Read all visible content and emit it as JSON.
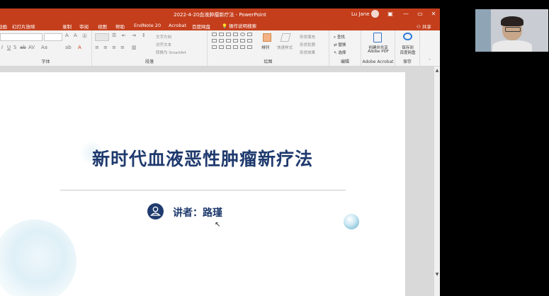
{
  "titlebar": {
    "doc_title": "2022-4-20血液肿瘤新疗法 - PowerPoint",
    "user_name": "Lu Jane",
    "minimize": "—",
    "restore": "▭",
    "close": "✕"
  },
  "tabs": [
    "动画",
    "幻灯片放映",
    "录制",
    "审阅",
    "视图",
    "帮助",
    "EndNote 20",
    "Acrobat",
    "百度网盘"
  ],
  "tell_me": "操作说明搜索",
  "share": "共享",
  "ribbon": {
    "groups": {
      "font": "字体",
      "paragraph": "段落",
      "drawing": "绘图",
      "editing": "编辑",
      "acrobat": "Adobe Acrobat",
      "save": "保存"
    },
    "paragraph": {
      "text_direction": "文字方向",
      "align_text": "对齐文本",
      "smartart": "转换为 SmartArt"
    },
    "drawing": {
      "arrange": "排列",
      "quick_styles": "快速样式",
      "shape_fill": "形状填充",
      "shape_outline": "形状轮廓",
      "shape_effects": "形状效果"
    },
    "editing": {
      "find": "查找",
      "replace": "替换",
      "select": "选择"
    },
    "acrobat": {
      "line1": "创建并共享",
      "line2": "Adobe PDF"
    },
    "baidu": {
      "line1": "保存到",
      "line2": "百度网盘"
    }
  },
  "slide": {
    "title": "新时代血液恶性肿瘤新疗法",
    "speaker": "讲者：路瑾"
  },
  "colors": {
    "accent": "#c43e1c",
    "title_navy": "#1f3a6e"
  }
}
